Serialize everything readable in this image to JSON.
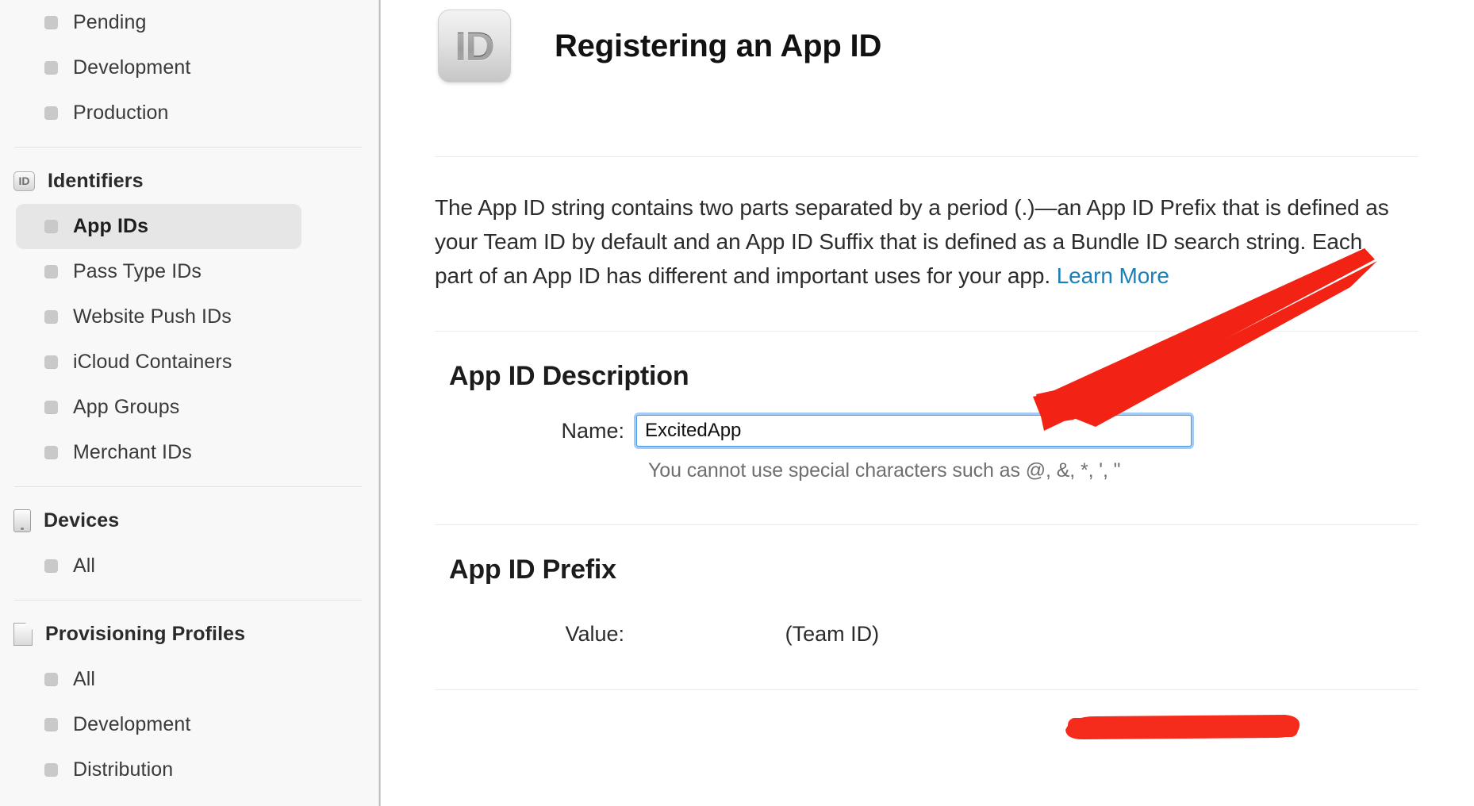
{
  "sidebar": {
    "top_items": [
      {
        "label": "Pending",
        "icon": "bullet-icon"
      },
      {
        "label": "Development",
        "icon": "bullet-icon"
      },
      {
        "label": "Production",
        "icon": "bullet-icon"
      }
    ],
    "sections": [
      {
        "title": "Identifiers",
        "icon": "id-badge-icon",
        "items": [
          {
            "label": "App IDs",
            "selected": true
          },
          {
            "label": "Pass Type IDs",
            "selected": false
          },
          {
            "label": "Website Push IDs",
            "selected": false
          },
          {
            "label": "iCloud Containers",
            "selected": false
          },
          {
            "label": "App Groups",
            "selected": false
          },
          {
            "label": "Merchant IDs",
            "selected": false
          }
        ]
      },
      {
        "title": "Devices",
        "icon": "device-icon",
        "items": [
          {
            "label": "All",
            "selected": false
          }
        ]
      },
      {
        "title": "Provisioning Profiles",
        "icon": "document-icon",
        "items": [
          {
            "label": "All",
            "selected": false
          },
          {
            "label": "Development",
            "selected": false
          },
          {
            "label": "Distribution",
            "selected": false
          }
        ]
      }
    ]
  },
  "header": {
    "icon_text": "ID",
    "icon_name": "app-id-badge-icon",
    "title": "Registering an App ID"
  },
  "intro": {
    "text": "The App ID string contains two parts separated by a period (.)—an App ID Prefix that is defined as your Team ID by default and an App ID Suffix that is defined as a Bundle ID search string. Each part of an App ID has different and important uses for your app. ",
    "link_label": "Learn More",
    "link_color": "#1b7fb8"
  },
  "description_section": {
    "title": "App ID Description",
    "name_label": "Name:",
    "name_value": "ExcitedApp",
    "name_placeholder": "",
    "hint": "You cannot use special characters such as @, &, *, ', \""
  },
  "prefix_section": {
    "title": "App ID Prefix",
    "value_label": "Value:",
    "value_text": "(Team ID)",
    "value_redacted": true
  },
  "annotations": {
    "arrow_color": "#f22314",
    "redaction_color": "#f52b1b",
    "arrow_name": "red-annotation-arrow",
    "redaction_name": "red-redaction-scribble"
  },
  "colors": {
    "sidebar_bg": "#f8f8f8",
    "selected_row_bg": "#e6e6e6",
    "focus_ring": "#4a9ae6",
    "link": "#1b7fb8",
    "annotation_red": "#f22314"
  }
}
